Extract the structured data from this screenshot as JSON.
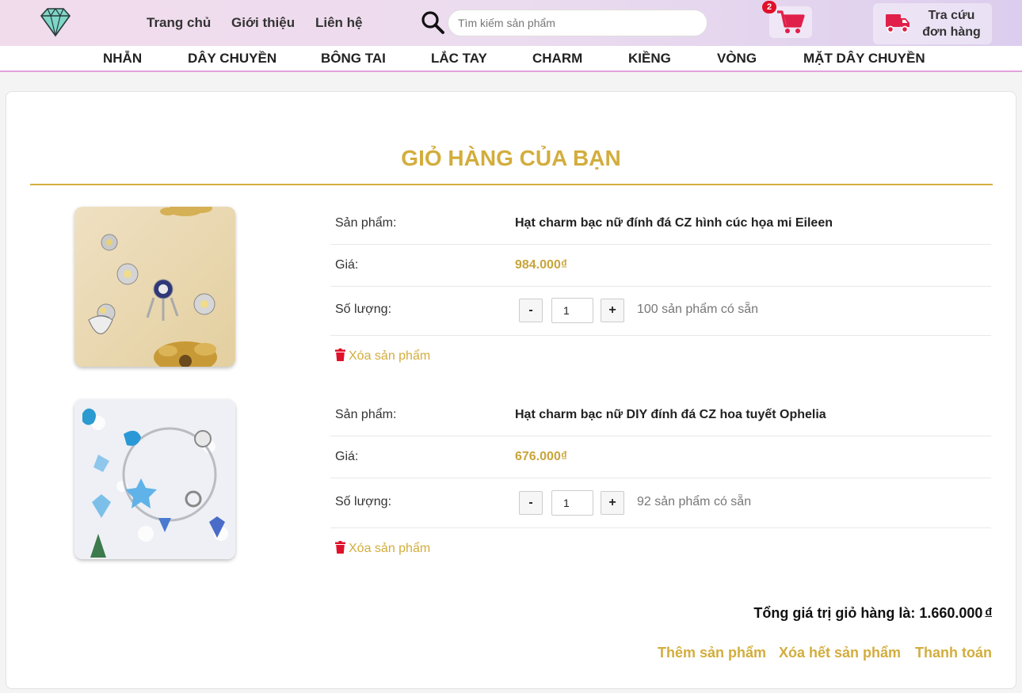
{
  "header": {
    "logo_icon": "diamond-icon",
    "nav": [
      "Trang chủ",
      "Giới thiệu",
      "Liên hệ"
    ],
    "search_placeholder": "Tìm kiếm sản phẩm",
    "cart_count": "2",
    "track_order_line1": "Tra cứu",
    "track_order_line2": "đơn hàng"
  },
  "categories": [
    "NHẪN",
    "DÂY CHUYỀN",
    "BÔNG TAI",
    "LẮC TAY",
    "CHARM",
    "KIỀNG",
    "VÒNG",
    "MẶT DÂY CHUYỀN"
  ],
  "cart": {
    "title": "GIỎ HÀNG CỦA BẠN",
    "labels": {
      "product": "Sản phẩm:",
      "price": "Giá:",
      "quantity": "Số lượng:",
      "remove": "Xóa sản phẩm"
    },
    "items": [
      {
        "name": "Hạt charm bạc nữ đính đá CZ hình cúc họa mi Eileen",
        "price": "984.000₫",
        "quantity": "1",
        "stock": "100 sản phẩm có sẵn"
      },
      {
        "name": "Hạt charm bạc nữ DIY đính đá CZ hoa tuyết Ophelia",
        "price": "676.000₫",
        "quantity": "1",
        "stock": "92 sản phẩm có sẵn"
      }
    ],
    "total_label": "Tổng giá trị giỏ hàng là: 1.660.000",
    "total_currency": "đ",
    "actions": [
      "Thêm sản phẩm",
      "Xóa hết sản phẩm",
      "Thanh toán"
    ]
  },
  "colors": {
    "accent_gold": "#d3ad3d",
    "cart_red": "#e0204a",
    "badge_red": "#e0102a"
  }
}
